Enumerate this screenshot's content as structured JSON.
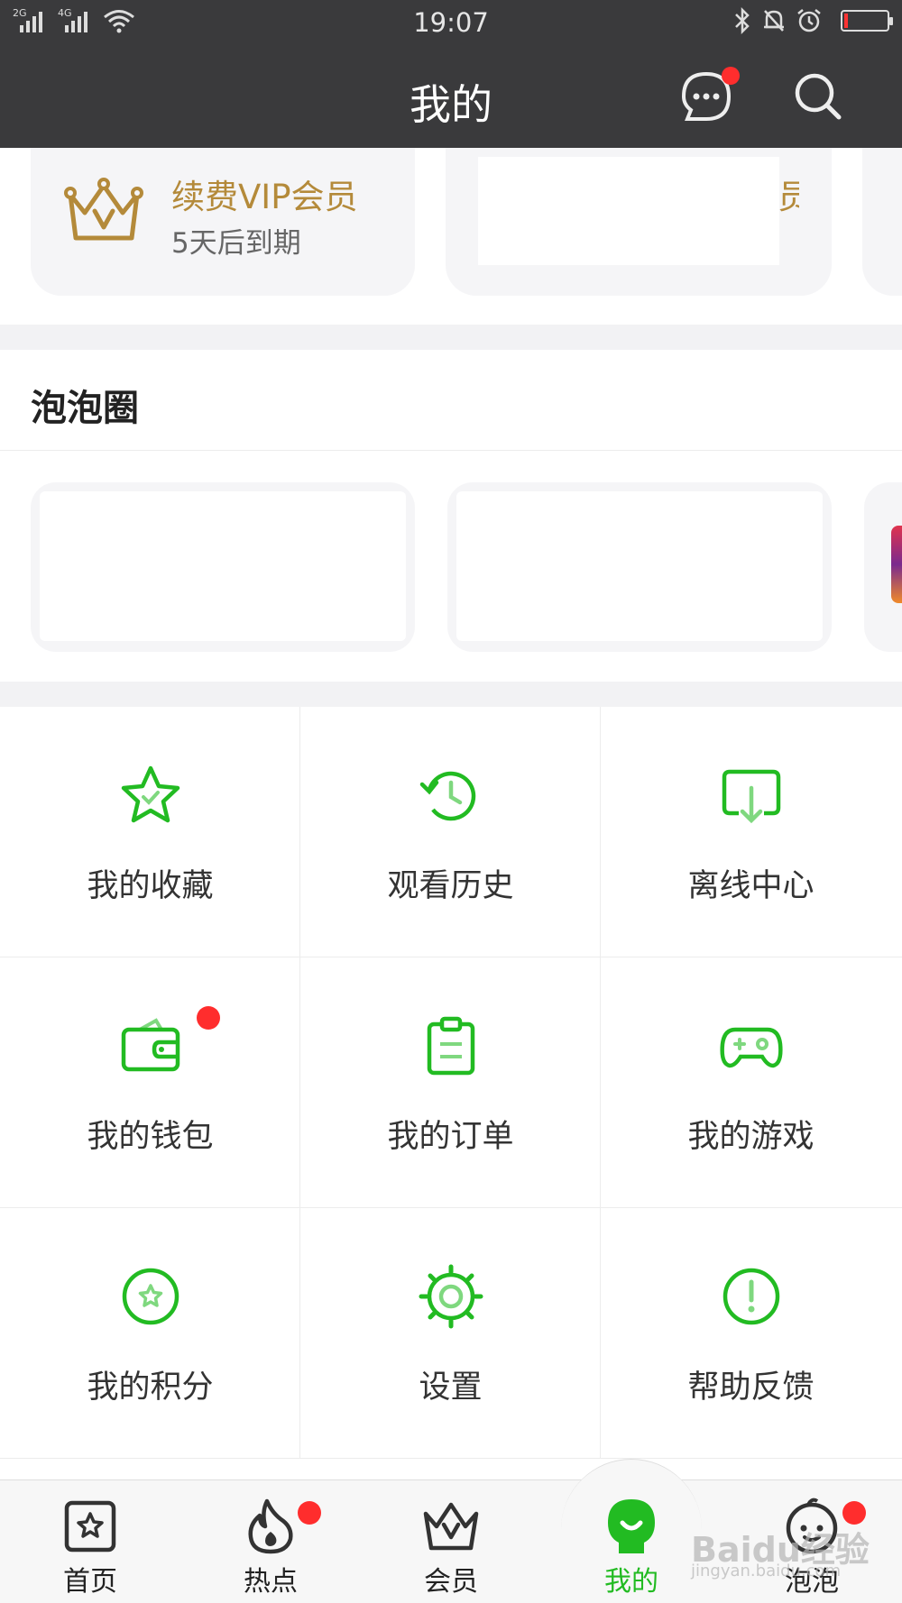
{
  "status_bar": {
    "time": "19:07",
    "sim1_label": "2G",
    "sim2_label": "4G",
    "icons": [
      "signal-icon",
      "wifi-icon",
      "bluetooth-icon",
      "bell-icon",
      "alarm-icon",
      "battery-icon"
    ],
    "battery_color": "#ff3333"
  },
  "header": {
    "title": "我的",
    "message_icon": "chat-bubble-icon",
    "search_icon": "search-icon",
    "badge_color": "#ff2d2d"
  },
  "vip": {
    "title": "续费VIP会员",
    "subtitle": "5天后到期",
    "second_card_fragment": "员",
    "accent_color": "#b48a3a"
  },
  "bubble_circle": {
    "title": "泡泡圈"
  },
  "menu": {
    "accent_color": "#22bb22",
    "items": [
      {
        "label": "我的收藏",
        "icon": "star-icon"
      },
      {
        "label": "观看历史",
        "icon": "history-clock-icon"
      },
      {
        "label": "离线中心",
        "icon": "download-icon"
      },
      {
        "label": "我的钱包",
        "icon": "wallet-icon"
      },
      {
        "label": "我的订单",
        "icon": "clipboard-icon"
      },
      {
        "label": "我的游戏",
        "icon": "gamepad-icon"
      },
      {
        "label": "我的积分",
        "icon": "points-star-icon"
      },
      {
        "label": "设置",
        "icon": "gear-icon"
      },
      {
        "label": "帮助反馈",
        "icon": "help-exclamation-icon"
      }
    ]
  },
  "tabs": [
    {
      "label": "首页",
      "icon": "home-star-icon"
    },
    {
      "label": "热点",
      "icon": "flame-icon"
    },
    {
      "label": "会员",
      "icon": "crown-icon"
    },
    {
      "label": "我的",
      "icon": "profile-icon",
      "active": true
    },
    {
      "label": "泡泡",
      "icon": "bubble-face-icon"
    }
  ],
  "watermark": {
    "brand": "Baidu经验",
    "url": "jingyan.baidu.com"
  }
}
